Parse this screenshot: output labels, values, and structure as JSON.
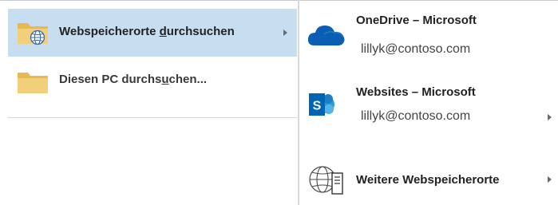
{
  "left_menu": {
    "items": [
      {
        "label_pre": "Webspeicherorte ",
        "label_ul": "d",
        "label_post": "urchsuchen",
        "icon": "folder-globe-icon",
        "selected": true
      },
      {
        "label_pre": "Diesen PC durchs",
        "label_ul": "u",
        "label_post": "chen...",
        "icon": "folder-icon",
        "selected": false
      }
    ]
  },
  "right_panel": {
    "items": [
      {
        "title": "OneDrive – Microsoft",
        "subtitle": "lillyk@contoso.com",
        "icon": "onedrive-cloud-icon",
        "has_submenu": false
      },
      {
        "title": "Websites – Microsoft",
        "subtitle": "lillyk@contoso.com",
        "icon": "sharepoint-icon",
        "has_submenu": true
      },
      {
        "title": "Weitere Webspeicherorte",
        "subtitle": "",
        "icon": "globe-server-icon",
        "has_submenu": true
      }
    ]
  },
  "colors": {
    "selection": "#c7def1",
    "folder": "#f2cf7b",
    "onedrive": "#0a5fb4",
    "sharepoint": "#0078d4"
  }
}
